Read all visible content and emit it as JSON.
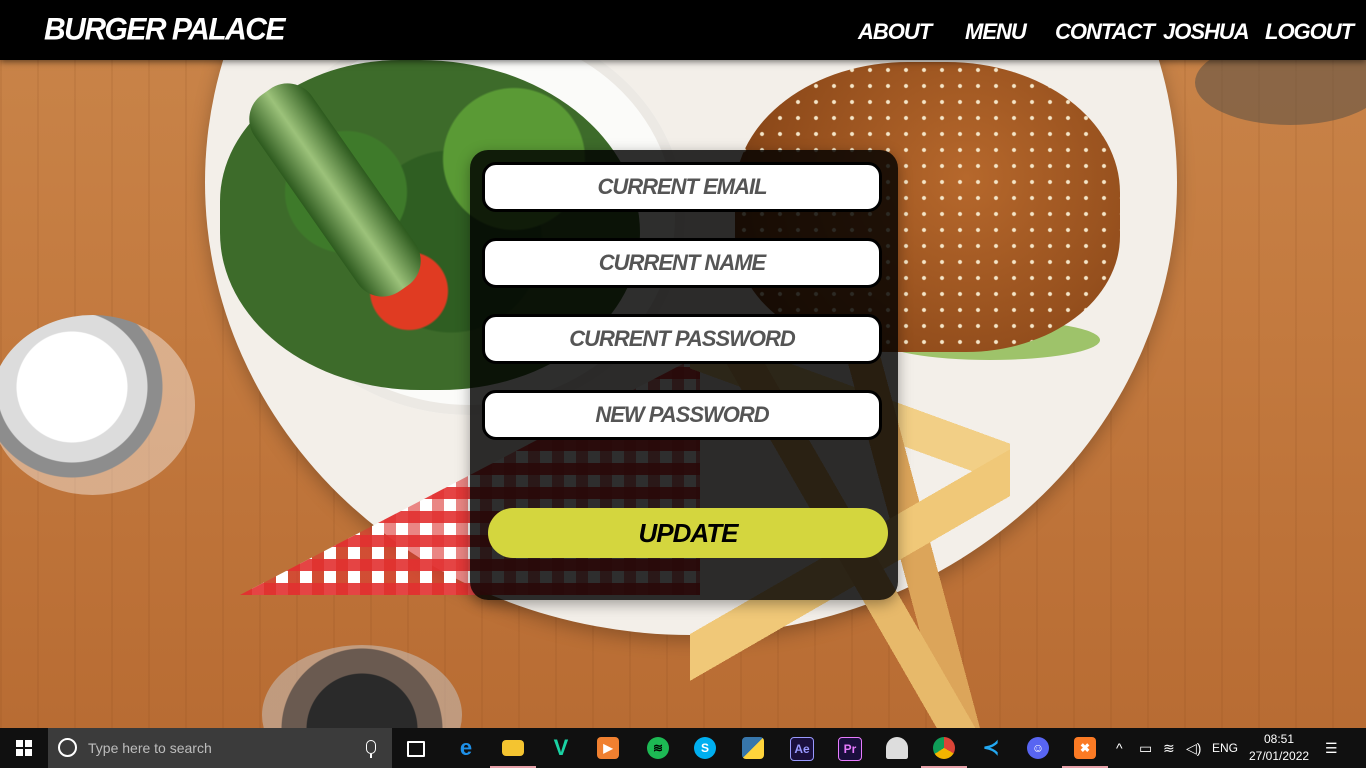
{
  "navbar": {
    "brand": "BURGER PALACE",
    "links": [
      "ABOUT",
      "MENU",
      "CONTACT",
      "JOSHUA",
      "LOGOUT"
    ]
  },
  "form": {
    "current_email_placeholder": "CURRENT EMAIL",
    "current_name_placeholder": "CURRENT NAME",
    "current_password_placeholder": "CURRENT PASSWORD",
    "new_password_placeholder": "NEW PASSWORD",
    "update_label": "UPDATE"
  },
  "taskbar": {
    "search_placeholder": "Type here to search",
    "apps": [
      "task-view-icon",
      "edge-icon",
      "file-explorer-icon",
      "vine-icon",
      "media-player-icon",
      "spotify-icon",
      "skype-icon",
      "python-icon",
      "after-effects-icon",
      "premiere-icon",
      "inkscape-icon",
      "chrome-icon",
      "vscode-icon",
      "discord-icon",
      "xampp-icon"
    ],
    "after_effects_label": "Ae",
    "premiere_label": "Pr",
    "language": "ENG",
    "time": "08:51",
    "date": "27/01/2022"
  },
  "colors": {
    "accent": "#d4d63e",
    "navbar": "#000000",
    "panel": "#000000"
  }
}
